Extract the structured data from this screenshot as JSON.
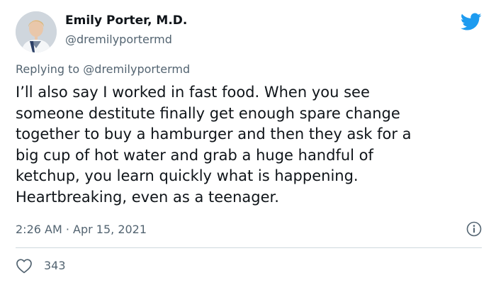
{
  "author": {
    "name": "Emily Porter, M.D.",
    "handle": "@dremilyportermd"
  },
  "reply": {
    "prefix": "Replying to",
    "mention": "@dremilyportermd"
  },
  "tweet": {
    "lines": [
      "I’ll also say I worked in fast food. When you see",
      "someone destitute finally get enough spare change",
      "together to buy a hamburger and then they ask for a",
      "big cup of hot water and grab a huge handful of",
      "ketchup, you learn quickly what is happening.",
      "Heartbreaking, even as a teenager."
    ],
    "timestamp": "2:26 AM · Apr 15, 2021",
    "likes": "343"
  },
  "icons": {
    "brand": "twitter-bird-icon",
    "info": "info-icon",
    "like": "heart-icon"
  },
  "colors": {
    "brand": "#1d9bf0",
    "text": "#0f1419",
    "secondary": "#536471",
    "divider": "#cfd9de"
  }
}
